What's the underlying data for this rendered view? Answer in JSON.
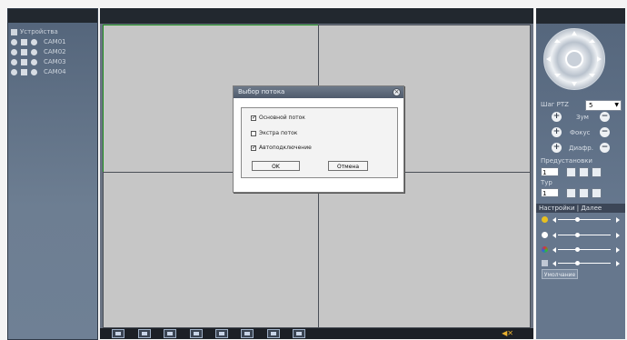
{
  "left_panel": {
    "root_label": "Устройства",
    "cameras": [
      {
        "label": "CAM01"
      },
      {
        "label": "CAM02"
      },
      {
        "label": "CAM03"
      },
      {
        "label": "CAM04"
      }
    ]
  },
  "ptz": {
    "step_label": "Шаг PTZ",
    "step_value": "5",
    "zoom_label": "Зум",
    "focus_label": "Фокус",
    "iris_label": "Диафр.",
    "presets_label": "Предустановки",
    "preset_value": "1",
    "tour_label": "Тур",
    "tour_value": "1"
  },
  "image_settings": {
    "tab_label": "Настройки | Далее",
    "sliders": [
      {
        "name": "brightness",
        "level": 0.35,
        "color": "#e8c020"
      },
      {
        "name": "contrast",
        "level": 0.35,
        "color": "#ffffff"
      },
      {
        "name": "saturation",
        "level": 0.35,
        "color": "#d04080"
      },
      {
        "name": "hue",
        "level": 0.35,
        "color": "#c0c8d4"
      }
    ],
    "default_label": "Умолчание"
  },
  "dialog": {
    "title": "Выбор потока",
    "options": [
      {
        "label": "Основной поток",
        "checked": true
      },
      {
        "label": "Экстра поток",
        "checked": false
      },
      {
        "label": "Автоподключение",
        "checked": true
      }
    ],
    "ok_label": "OK",
    "cancel_label": "Отмена"
  },
  "toolbar": {
    "icons": [
      "fullscreen-icon",
      "single-view-icon",
      "quad-view-icon",
      "record-icon",
      "record-all-icon",
      "snapshot-icon",
      "talk-icon",
      "stop-icon"
    ],
    "speaker_icon": "speaker-muted-icon"
  }
}
